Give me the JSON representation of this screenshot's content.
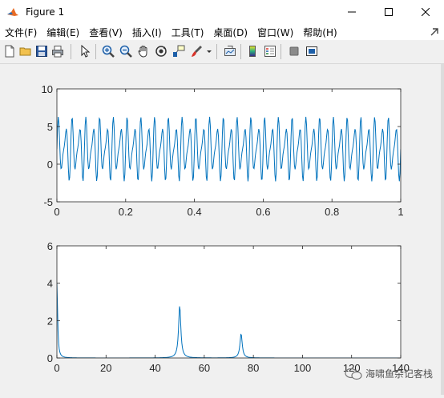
{
  "window": {
    "title": "Figure 1"
  },
  "menu": [
    "文件(F)",
    "编辑(E)",
    "查看(V)",
    "插入(I)",
    "工具(T)",
    "桌面(D)",
    "窗口(W)",
    "帮助(H)"
  ],
  "toolbar": {
    "buttons": [
      "new-figure",
      "open-file",
      "save",
      "print",
      "edit-plot",
      "zoom-in",
      "zoom-out",
      "pan",
      "rotate-3d",
      "data-cursor",
      "brush",
      "link-plot",
      "insert-colorbar",
      "insert-legend",
      "hide-plot-tools",
      "show-plot-tools"
    ]
  },
  "chart_data": [
    {
      "type": "line",
      "title": "",
      "xlabel": "",
      "ylabel": "",
      "xlim": [
        0,
        1
      ],
      "ylim": [
        -5,
        10
      ],
      "xticks": [
        "0",
        "0.2",
        "0.4",
        "0.6",
        "0.8",
        "1"
      ],
      "yticks": [
        "-5",
        "0",
        "5",
        "10"
      ],
      "series": [
        {
          "color": "#0072bd",
          "formula": "2 + 3*sin(2*pi*50*t) + 1.5*sin(2*pi*75*t)",
          "samples": 512
        }
      ]
    },
    {
      "type": "line",
      "title": "",
      "xlabel": "",
      "ylabel": "",
      "xlim": [
        0,
        140
      ],
      "ylim": [
        0,
        6
      ],
      "xticks": [
        "0",
        "20",
        "40",
        "60",
        "80",
        "100",
        "120",
        "140"
      ],
      "yticks": [
        "0",
        "2",
        "4",
        "6"
      ],
      "series": [
        {
          "color": "#0072bd",
          "peaks": [
            {
              "x": 0,
              "y": 4.0
            },
            {
              "x": 50,
              "y": 2.8
            },
            {
              "x": 75,
              "y": 1.3
            }
          ]
        }
      ]
    }
  ],
  "watermark": {
    "text": "海啸鱼杂记客栈"
  }
}
